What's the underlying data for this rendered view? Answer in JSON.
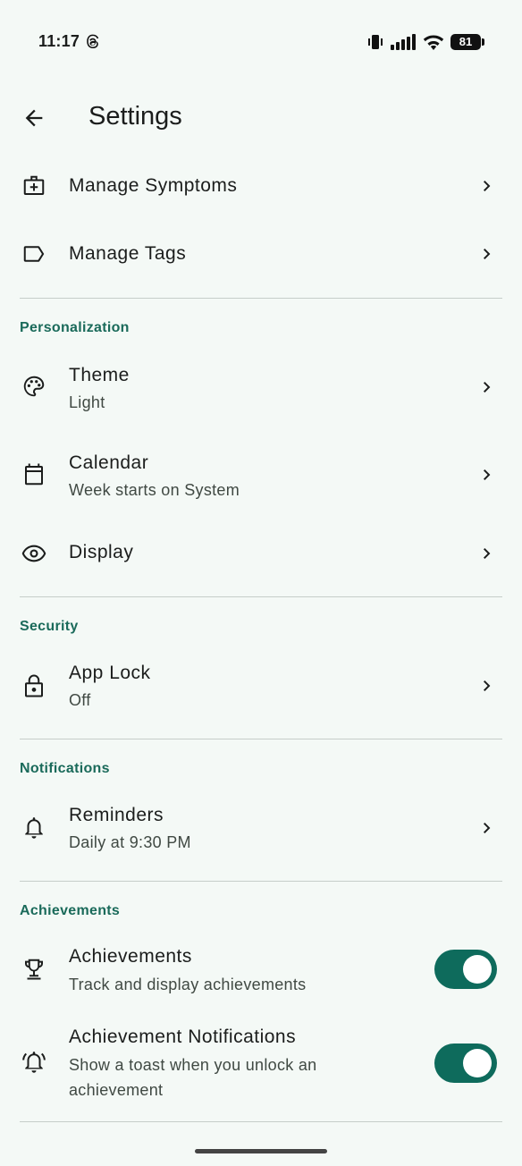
{
  "status_bar": {
    "time": "11:17",
    "battery": "81"
  },
  "app_bar": {
    "title": "Settings"
  },
  "items_top": [
    {
      "title": "Manage Symptoms",
      "icon": "medical-kit-icon"
    },
    {
      "title": "Manage Tags",
      "icon": "tag-icon"
    }
  ],
  "personalization": {
    "header": "Personalization",
    "theme": {
      "title": "Theme",
      "subtitle": "Light",
      "icon": "palette-icon"
    },
    "calendar": {
      "title": "Calendar",
      "subtitle": "Week starts on System",
      "icon": "calendar-icon"
    },
    "display": {
      "title": "Display",
      "icon": "eye-icon"
    }
  },
  "security": {
    "header": "Security",
    "app_lock": {
      "title": "App Lock",
      "subtitle": "Off",
      "icon": "lock-icon"
    }
  },
  "notifications": {
    "header": "Notifications",
    "reminders": {
      "title": "Reminders",
      "subtitle": "Daily at 9:30 PM",
      "icon": "bell-icon"
    }
  },
  "achievements": {
    "header": "Achievements",
    "achievements": {
      "title": "Achievements",
      "subtitle": "Track and display achievements",
      "icon": "trophy-icon",
      "enabled": true
    },
    "achievement_notifications": {
      "title": "Achievement Notifications",
      "subtitle": "Show a toast when you unlock an achievement",
      "icon": "bell-ringing-icon",
      "enabled": true
    }
  },
  "colors": {
    "accent": "#0e6b5c",
    "section_header": "#1a6a5a",
    "background": "#f4f9f6"
  }
}
